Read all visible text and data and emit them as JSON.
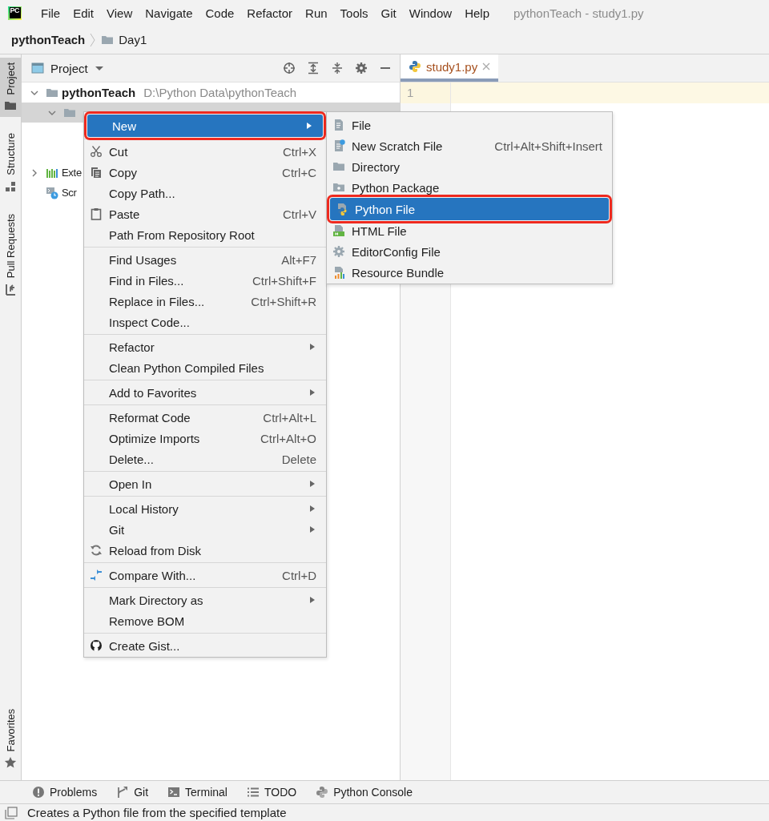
{
  "app_logo": {
    "text": "PC"
  },
  "menubar": {
    "menus": [
      "File",
      "Edit",
      "View",
      "Navigate",
      "Code",
      "Refactor",
      "Run",
      "Tools",
      "Git",
      "Window",
      "Help"
    ],
    "title": "pythonTeach - study1.py"
  },
  "breadcrumb": [
    {
      "label": "pythonTeach",
      "kind": "project"
    },
    {
      "label": "Day1",
      "kind": "folder"
    }
  ],
  "left_stripe": {
    "tabs": [
      {
        "label": "Project",
        "selected": true
      },
      {
        "label": "Structure",
        "selected": false
      },
      {
        "label": "Pull Requests",
        "selected": false
      }
    ],
    "bottom_tabs": [
      {
        "label": "Favorites",
        "selected": false
      }
    ]
  },
  "project_panel": {
    "title": "Project",
    "tree": [
      {
        "label": "pythonTeach",
        "path": "D:\\Python Data\\pythonTeach",
        "kind": "folder",
        "expanded": true,
        "selected": false,
        "children": [
          {
            "kind": "folder",
            "expanded": true,
            "selected": true
          }
        ]
      },
      {
        "label": "Exte",
        "kind": "libraries",
        "expanded": false,
        "selected": false
      },
      {
        "label": "Scr",
        "kind": "scratches",
        "selected": false
      }
    ]
  },
  "editor": {
    "tabs": [
      {
        "label": "study1.py",
        "selected": true
      }
    ],
    "line_numbers": [
      "1"
    ]
  },
  "context_menu": {
    "groups": [
      [
        {
          "label": "New",
          "kind": "plain",
          "submenu": true,
          "selected": true,
          "outlined": true
        }
      ],
      [
        {
          "label": "Cut",
          "kind": "cut",
          "shortcut": "Ctrl+X",
          "selected": false
        },
        {
          "label": "Copy",
          "kind": "copy",
          "shortcut": "Ctrl+C",
          "selected": false
        },
        {
          "label": "Copy Path...",
          "kind": "plain",
          "selected": false
        },
        {
          "label": "Paste",
          "kind": "paste",
          "shortcut": "Ctrl+V",
          "selected": false
        },
        {
          "label": "Path From Repository Root",
          "kind": "plain",
          "selected": false
        }
      ],
      [
        {
          "label": "Find Usages",
          "kind": "plain",
          "shortcut": "Alt+F7",
          "selected": false
        },
        {
          "label": "Find in Files...",
          "kind": "plain",
          "shortcut": "Ctrl+Shift+F",
          "selected": false
        },
        {
          "label": "Replace in Files...",
          "kind": "plain",
          "shortcut": "Ctrl+Shift+R",
          "selected": false
        },
        {
          "label": "Inspect Code...",
          "kind": "plain",
          "selected": false
        }
      ],
      [
        {
          "label": "Refactor",
          "kind": "plain",
          "submenu": true,
          "selected": false
        },
        {
          "label": "Clean Python Compiled Files",
          "kind": "plain",
          "selected": false
        }
      ],
      [
        {
          "label": "Add to Favorites",
          "kind": "plain",
          "submenu": true,
          "selected": false
        }
      ],
      [
        {
          "label": "Reformat Code",
          "kind": "plain",
          "shortcut": "Ctrl+Alt+L",
          "selected": false
        },
        {
          "label": "Optimize Imports",
          "kind": "plain",
          "shortcut": "Ctrl+Alt+O",
          "selected": false
        },
        {
          "label": "Delete...",
          "kind": "plain",
          "shortcut": "Delete",
          "selected": false
        }
      ],
      [
        {
          "label": "Open In",
          "kind": "plain",
          "submenu": true,
          "selected": false
        }
      ],
      [
        {
          "label": "Local History",
          "kind": "plain",
          "submenu": true,
          "selected": false
        },
        {
          "label": "Git",
          "kind": "plain",
          "submenu": true,
          "selected": false
        },
        {
          "label": "Reload from Disk",
          "kind": "reload",
          "selected": false
        }
      ],
      [
        {
          "label": "Compare With...",
          "kind": "compare",
          "shortcut": "Ctrl+D",
          "selected": false
        }
      ],
      [
        {
          "label": "Mark Directory as",
          "kind": "plain",
          "submenu": true,
          "selected": false
        },
        {
          "label": "Remove BOM",
          "kind": "plain",
          "selected": false
        }
      ],
      [
        {
          "label": "Create Gist...",
          "kind": "gist",
          "selected": false
        }
      ]
    ]
  },
  "submenu": {
    "items": [
      {
        "label": "File",
        "kind": "file",
        "selected": false
      },
      {
        "label": "New Scratch File",
        "kind": "scratch",
        "shortcut": "Ctrl+Alt+Shift+Insert",
        "selected": false
      },
      {
        "label": "Directory",
        "kind": "directory",
        "selected": false
      },
      {
        "label": "Python Package",
        "kind": "package",
        "selected": false
      },
      {
        "label": "Python File",
        "kind": "python",
        "selected": true,
        "outlined": true
      },
      {
        "label": "HTML File",
        "kind": "html",
        "selected": false
      },
      {
        "label": "EditorConfig File",
        "kind": "config",
        "selected": false
      },
      {
        "label": "Resource Bundle",
        "kind": "bundle",
        "selected": false
      }
    ]
  },
  "bottom_toolbar": {
    "tools": [
      {
        "label": "Problems",
        "kind": "problems"
      },
      {
        "label": "Git",
        "kind": "git"
      },
      {
        "label": "Terminal",
        "kind": "terminal"
      },
      {
        "label": "TODO",
        "kind": "todo"
      },
      {
        "label": "Python Console",
        "kind": "python"
      }
    ]
  },
  "status_bar": {
    "text": "Creates a Python file from the specified template"
  }
}
